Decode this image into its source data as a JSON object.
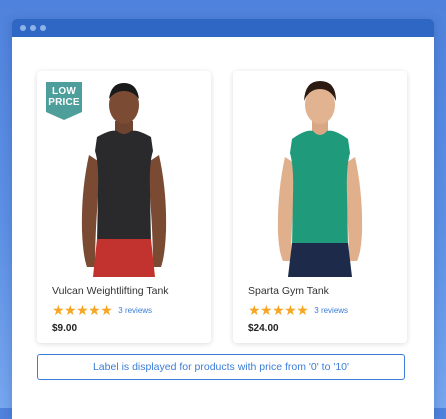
{
  "products": [
    {
      "name": "Vulcan Weightlifting Tank",
      "rating_stars": 5,
      "reviews": "3 reviews",
      "price": "$9.00",
      "badge": {
        "line1": "LOW",
        "line2": "PRICE"
      },
      "shirt_color": "#2a2a2c",
      "shorts_color": "#c2332f"
    },
    {
      "name": "Sparta Gym Tank",
      "rating_stars": 5,
      "reviews": "3 reviews",
      "price": "$24.00",
      "shirt_color": "#1f9a7a",
      "shorts_color": "#1e2a4a"
    }
  ],
  "info_note": "Label is displayed for products with price from '0' to '10'",
  "colors": {
    "accent": "#3b7dd8",
    "badge": "#4e9e9b",
    "star": "#f6a623",
    "titlebar": "#2f67c4"
  }
}
